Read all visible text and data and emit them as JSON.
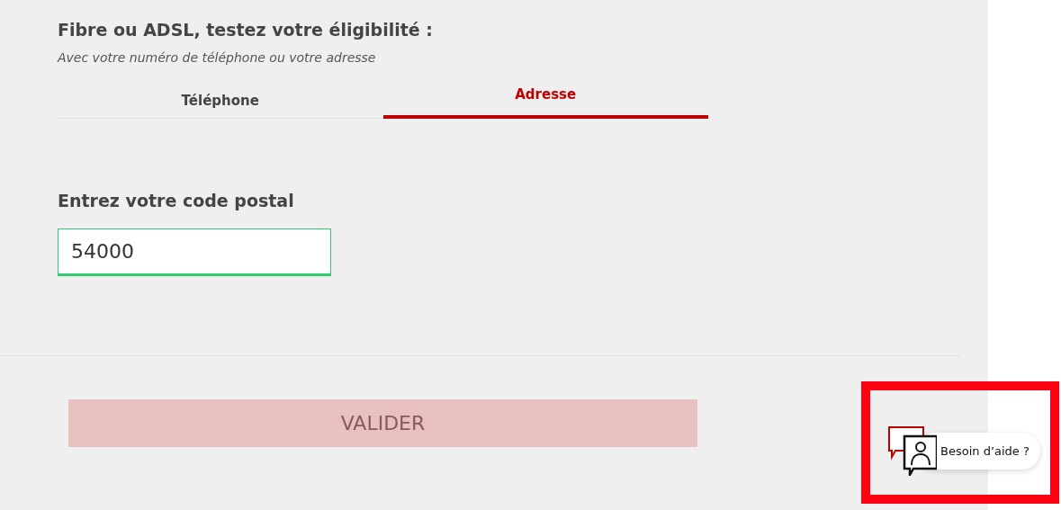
{
  "heading": "Fibre ou ADSL, testez votre éligibilité :",
  "subheading": "Avec votre numéro de téléphone ou votre adresse",
  "tabs": [
    {
      "label": "Téléphone",
      "selected": false
    },
    {
      "label": "Adresse",
      "selected": true
    }
  ],
  "postal_code": {
    "label": "Entrez votre code postal",
    "value": "54000",
    "valid": true
  },
  "submit": {
    "label": "VALIDER",
    "disabled": true
  },
  "help": {
    "label": "Besoin d’aide ?",
    "highlighted": true
  }
}
